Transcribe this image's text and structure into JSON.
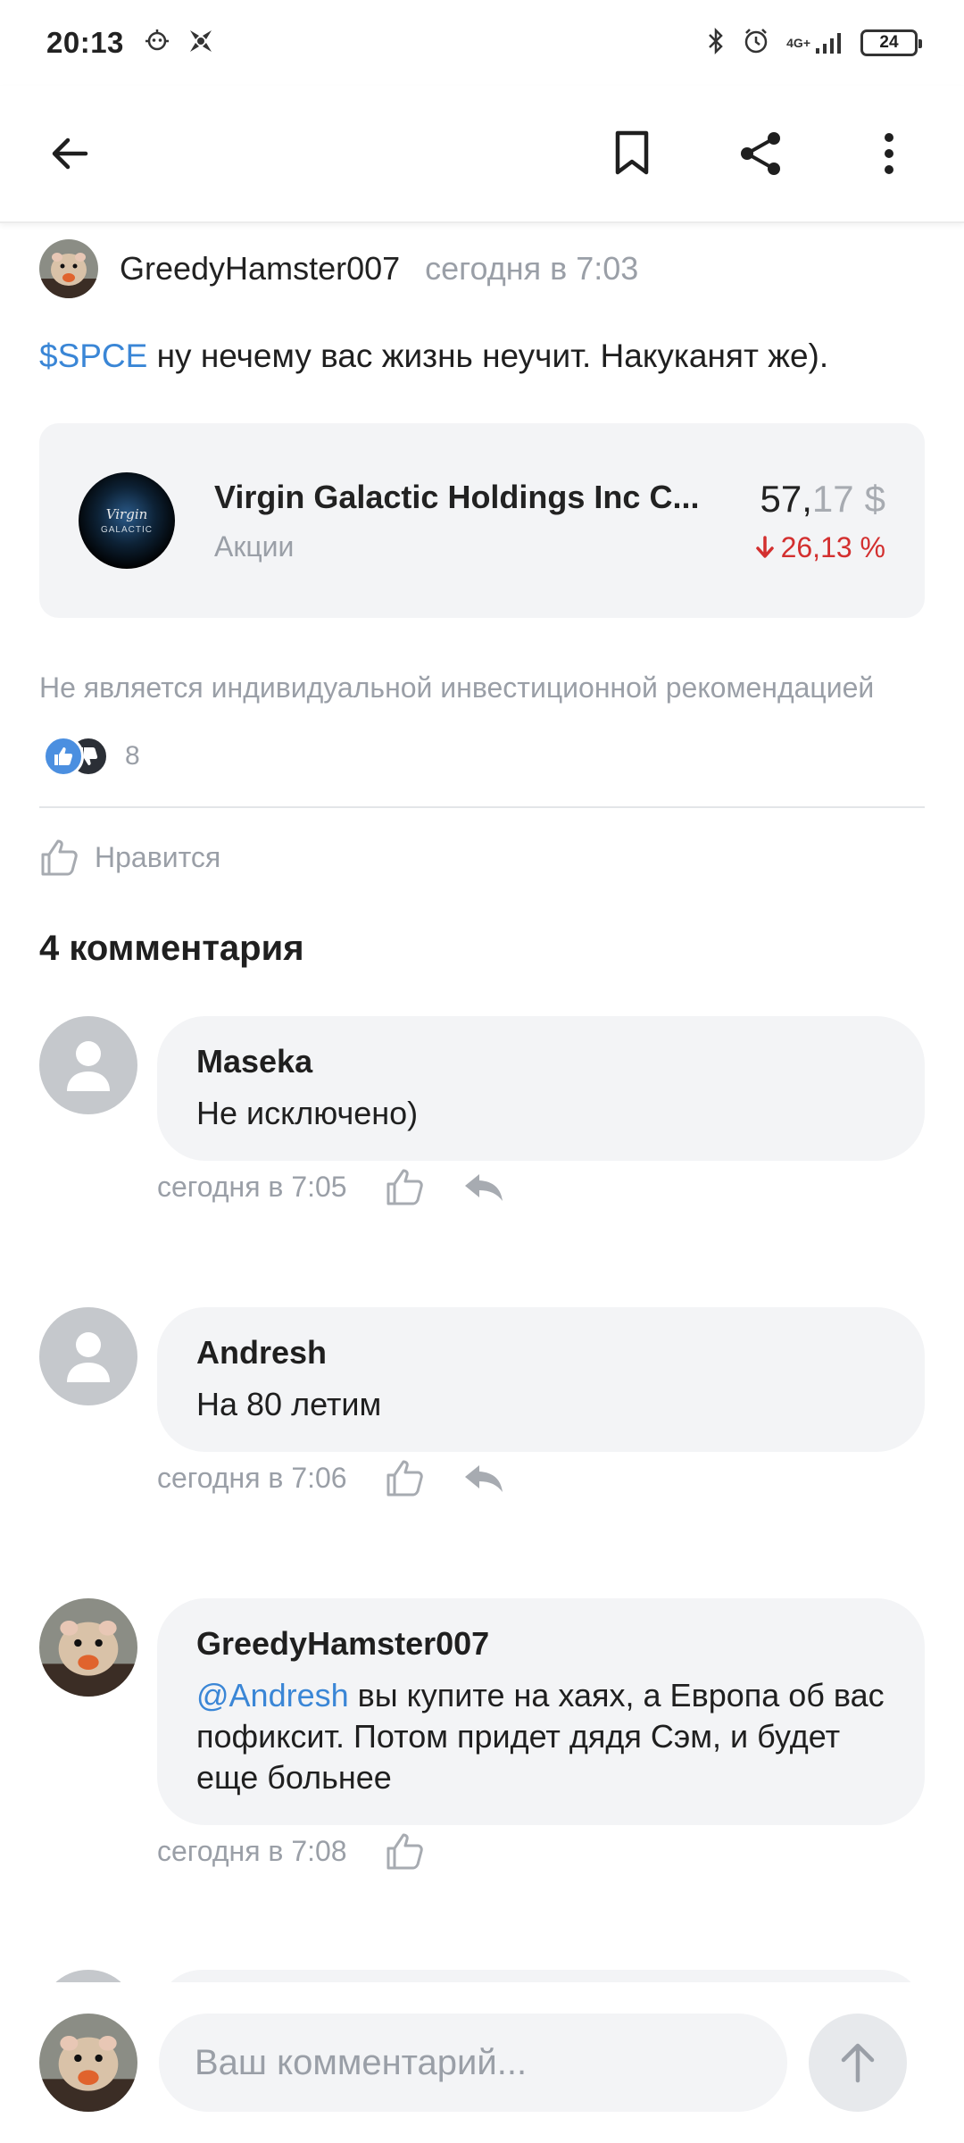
{
  "status_bar": {
    "time": "20:13",
    "network": "4G+",
    "battery": "24"
  },
  "app_bar": {
    "back_icon": "arrow-left-icon",
    "bookmark_icon": "bookmark-icon",
    "share_icon": "share-icon",
    "more_icon": "more-vertical-icon"
  },
  "post": {
    "author": "GreedyHamster007",
    "time": "сегодня в 7:03",
    "ticker": "$SPCE",
    "text": " ну нечему вас жизнь неучит. Накуканят же).",
    "instrument": {
      "name": "Virgin Galactic Holdings Inc C...",
      "type": "Акции",
      "price_int": "57,",
      "price_frac": "17",
      "currency": "$",
      "change": "26,13 %",
      "change_direction": "down",
      "change_color": "#d32f2f",
      "logo_line1": "Virgin",
      "logo_line2": "GALACTIC"
    },
    "disclaimer": "Не является индивидуальной инвестиционной рекомендацией",
    "reactions_count": "8",
    "like_label": "Нравится"
  },
  "comments_title": "4 комментария",
  "comments": [
    {
      "author": "Maseka",
      "text": "Не исключено)",
      "time": "сегодня в 7:05"
    },
    {
      "author": "Andresh",
      "text": "На 80 летим",
      "time": "сегодня в 7:06"
    },
    {
      "author": "GreedyHamster007",
      "mention": "@Andresh",
      "text": " вы купите на хаях, а Европа об вас пофиксит. Потом придет дядя Сэм, и будет еще больнее",
      "time": "сегодня в 7:08"
    }
  ],
  "composer": {
    "placeholder": "Ваш комментарий..."
  },
  "colors": {
    "accent": "#3a86d6",
    "negative": "#d32f2f",
    "muted": "#9a9fa7",
    "bubble": "#f3f4f6"
  }
}
